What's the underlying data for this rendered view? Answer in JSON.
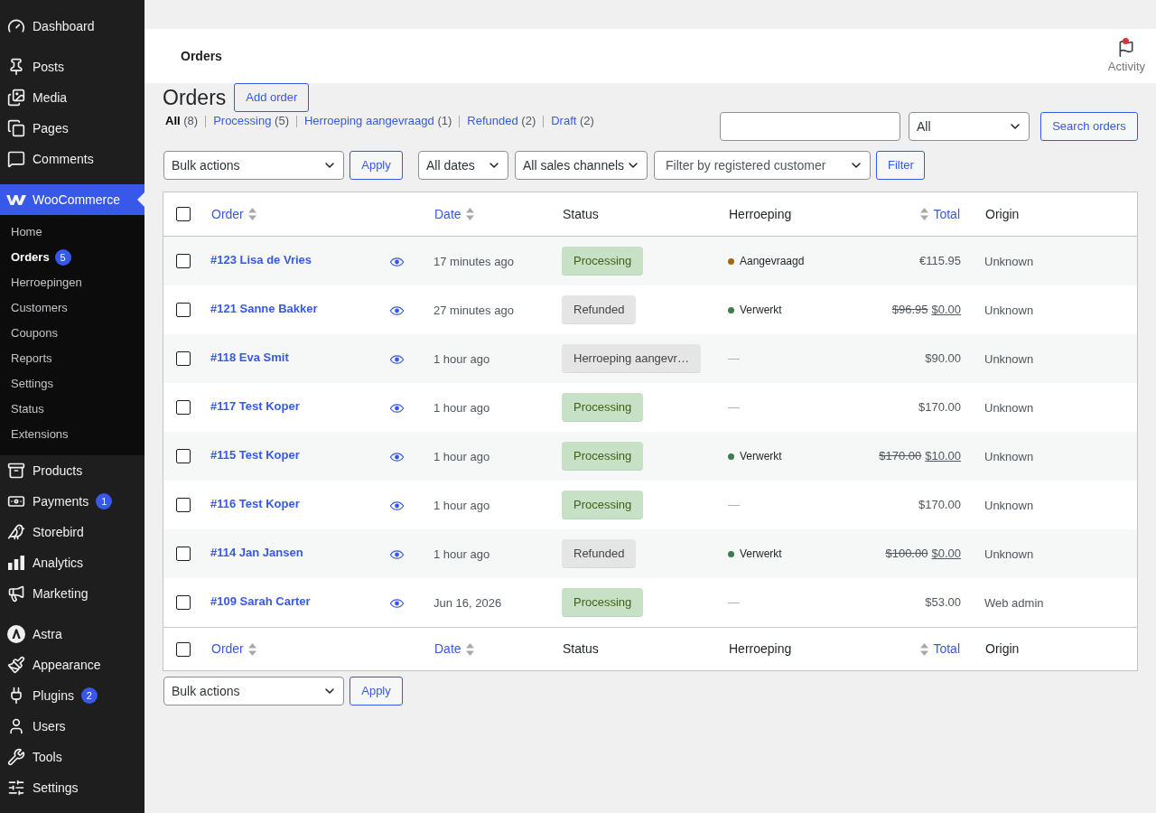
{
  "sidebar": {
    "groups": [
      {
        "items": [
          {
            "label": "Dashboard",
            "selected": false
          }
        ]
      },
      {
        "items": [
          {
            "label": "Posts",
            "selected": false
          },
          {
            "label": "Media",
            "selected": false
          },
          {
            "label": "Pages",
            "selected": false
          },
          {
            "label": "Comments",
            "selected": false
          }
        ]
      },
      {
        "items": [
          {
            "label": "WooCommerce",
            "selected": true,
            "children": [
              {
                "label": "Home",
                "selected": false
              },
              {
                "label": "Orders",
                "selected": true,
                "badge": "5"
              },
              {
                "label": "Herroepingen",
                "selected": false
              },
              {
                "label": "Customers",
                "selected": false
              },
              {
                "label": "Coupons",
                "selected": false
              },
              {
                "label": "Reports",
                "selected": false
              },
              {
                "label": "Settings",
                "selected": false
              },
              {
                "label": "Status",
                "selected": false
              },
              {
                "label": "Extensions",
                "selected": false
              }
            ]
          },
          {
            "label": "Products",
            "selected": false
          },
          {
            "label": "Payments",
            "selected": false,
            "badge": "1"
          },
          {
            "label": "Storebird",
            "selected": false
          },
          {
            "label": "Analytics",
            "selected": false
          },
          {
            "label": "Marketing",
            "selected": false
          }
        ]
      },
      {
        "items": [
          {
            "label": "Astra",
            "selected": false
          },
          {
            "label": "Appearance",
            "selected": false
          },
          {
            "label": "Plugins",
            "selected": false,
            "badge": "2"
          },
          {
            "label": "Users",
            "selected": false
          },
          {
            "label": "Tools",
            "selected": false
          },
          {
            "label": "Settings",
            "selected": false
          }
        ]
      }
    ]
  },
  "header": {
    "title": "Orders",
    "activity": {
      "label": "Activity",
      "unread": true
    }
  },
  "page": {
    "heading": "Orders",
    "add_button": "Add order"
  },
  "status_filters": [
    {
      "label": "All",
      "count": "(8)",
      "selected": true
    },
    {
      "label": "Processing",
      "count": "(5)",
      "selected": false
    },
    {
      "label": "Herroeping aangevraagd",
      "count": "(1)",
      "selected": false
    },
    {
      "label": "Refunded",
      "count": "(2)",
      "selected": false
    },
    {
      "label": "Draft",
      "count": "(2)",
      "selected": false
    }
  ],
  "search": {
    "scope": "All",
    "button": "Search orders"
  },
  "tablenav_top": {
    "bulk_action": "Bulk actions",
    "apply": "Apply",
    "filters": [
      {
        "value": "All dates"
      },
      {
        "value": "All sales channels"
      },
      {
        "placeholder": "Filter by registered customer"
      }
    ],
    "filter_button": "Filter"
  },
  "table": {
    "header": {
      "checked": false,
      "columns": [
        {
          "label": "Order",
          "kind": "sortable"
        },
        {
          "label": "Date",
          "kind": "sortable"
        },
        {
          "label": "Status",
          "kind": "plain"
        },
        {
          "label": "Herroeping",
          "kind": "plain"
        },
        {
          "label": "Total",
          "kind": "sortable"
        },
        {
          "label": "Origin",
          "kind": "plain"
        }
      ]
    },
    "rows": [
      {
        "checked": false,
        "order": "#123 Lisa de Vries",
        "date": "17 minutes ago",
        "status": {
          "label": "Processing",
          "kind": "processing"
        },
        "herroeping": {
          "kind": "status",
          "label": "Aangevraagd",
          "color": "#a26a10"
        },
        "total": {
          "value": "€115.95"
        },
        "origin": "Unknown"
      },
      {
        "checked": false,
        "order": "#121 Sanne Bakker",
        "date": "27 minutes ago",
        "status": {
          "label": "Refunded",
          "kind": "refunded"
        },
        "herroeping": {
          "kind": "status",
          "label": "Verwerkt",
          "color": "#3e7c4f"
        },
        "total": {
          "original": "$96.95",
          "value": "$0.00"
        },
        "origin": "Unknown"
      },
      {
        "checked": false,
        "order": "#118 Eva Smit",
        "date": "1 hour ago",
        "status": {
          "label": "Herroeping aangevr…",
          "kind": "other"
        },
        "herroeping": {
          "kind": "empty",
          "label": "—"
        },
        "total": {
          "value": "$90.00"
        },
        "origin": "Unknown"
      },
      {
        "checked": false,
        "order": "#117 Test Koper",
        "date": "1 hour ago",
        "status": {
          "label": "Processing",
          "kind": "processing"
        },
        "herroeping": {
          "kind": "empty",
          "label": "—"
        },
        "total": {
          "value": "$170.00"
        },
        "origin": "Unknown"
      },
      {
        "checked": false,
        "order": "#115 Test Koper",
        "date": "1 hour ago",
        "status": {
          "label": "Processing",
          "kind": "processing"
        },
        "herroeping": {
          "kind": "status",
          "label": "Verwerkt",
          "color": "#3e7c4f"
        },
        "total": {
          "original": "$170.00",
          "value": "$10.00"
        },
        "origin": "Unknown"
      },
      {
        "checked": false,
        "order": "#116 Test Koper",
        "date": "1 hour ago",
        "status": {
          "label": "Processing",
          "kind": "processing"
        },
        "herroeping": {
          "kind": "empty",
          "label": "—"
        },
        "total": {
          "value": "$170.00"
        },
        "origin": "Unknown"
      },
      {
        "checked": false,
        "order": "#114 Jan Jansen",
        "date": "1 hour ago",
        "status": {
          "label": "Refunded",
          "kind": "refunded"
        },
        "herroeping": {
          "kind": "status",
          "label": "Verwerkt",
          "color": "#3e7c4f"
        },
        "total": {
          "original": "$100.00",
          "value": "$0.00"
        },
        "origin": "Unknown"
      },
      {
        "checked": false,
        "order": "#109 Sarah Carter",
        "date": "Jun 16, 2026",
        "status": {
          "label": "Processing",
          "kind": "processing"
        },
        "herroeping": {
          "kind": "empty",
          "label": "—"
        },
        "total": {
          "value": "$53.00"
        },
        "origin": "Web admin"
      }
    ],
    "footer": {
      "checked": false,
      "columns": [
        {
          "label": "Order",
          "kind": "sortable"
        },
        {
          "label": "Date",
          "kind": "sortable"
        },
        {
          "label": "Status",
          "kind": "plain"
        },
        {
          "label": "Herroeping",
          "kind": "plain"
        },
        {
          "label": "Total",
          "kind": "sortable"
        },
        {
          "label": "Origin",
          "kind": "plain"
        }
      ]
    }
  },
  "tablenav_bottom": {
    "bulk_action": "Bulk actions",
    "apply": "Apply"
  }
}
